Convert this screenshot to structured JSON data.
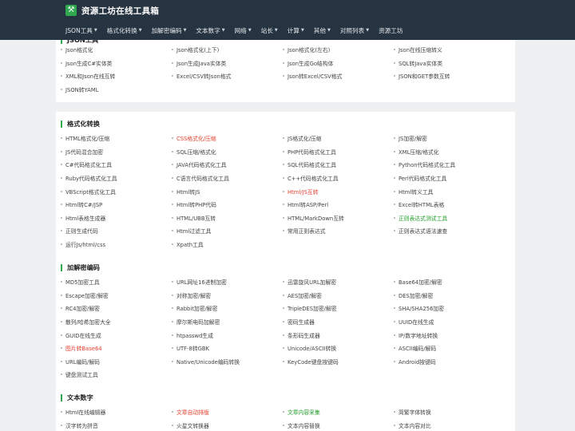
{
  "app": {
    "title": "资源工坊在线工具箱",
    "logo_icon": "wrench-icon",
    "accent_color": "#2fa84f",
    "topbar_color": "#263340"
  },
  "nav": [
    {
      "label": "JSON工具",
      "dropdown": true
    },
    {
      "label": "格式化转换",
      "dropdown": true
    },
    {
      "label": "加解密编码",
      "dropdown": true
    },
    {
      "label": "文本数字",
      "dropdown": true
    },
    {
      "label": "网络",
      "dropdown": true
    },
    {
      "label": "站长",
      "dropdown": true
    },
    {
      "label": "计算",
      "dropdown": true
    },
    {
      "label": "其他",
      "dropdown": true
    },
    {
      "label": "对照列表",
      "dropdown": true
    },
    {
      "label": "资源工坊",
      "dropdown": false
    }
  ],
  "link_colors": {
    "red": "#e4422f",
    "green": "#23a02b"
  },
  "sections": [
    {
      "title": "JSON工具",
      "items": [
        {
          "label": "Json格式化"
        },
        {
          "label": "Json格式化(上下)"
        },
        {
          "label": "Json格式化(左右)"
        },
        {
          "label": "Json在线压缩转义"
        },
        {
          "label": "Json生成C#实体类"
        },
        {
          "label": "Json生成Java实体类"
        },
        {
          "label": "Json生成Go结构体"
        },
        {
          "label": "SQL转Java实体类"
        },
        {
          "label": "XML和Json在线互转"
        },
        {
          "label": "Excel/CSV转Json格式"
        },
        {
          "label": "Json转Excel/CSV格式"
        },
        {
          "label": "JSON和GET参数互转"
        },
        {
          "label": "JSON转YAML"
        }
      ]
    },
    {
      "title": "格式化转换",
      "items": [
        {
          "label": "HTML格式化/压缩"
        },
        {
          "label": "CSS格式化/压缩",
          "color": "red"
        },
        {
          "label": "JS格式化/压缩"
        },
        {
          "label": "JS加密/解密"
        },
        {
          "label": "JS代码混合加密"
        },
        {
          "label": "SQL压缩/格式化"
        },
        {
          "label": "PHP代码格式化工具"
        },
        {
          "label": "XML压缩/格式化"
        },
        {
          "label": "C#代码格式化工具"
        },
        {
          "label": "JAVA代码格式化工具"
        },
        {
          "label": "SQL代码格式化工具"
        },
        {
          "label": "Python代码格式化工具"
        },
        {
          "label": "Ruby代码格式化工具"
        },
        {
          "label": "C语言代码格式化工具"
        },
        {
          "label": "C++代码格式化工具"
        },
        {
          "label": "Perl代码格式化工具"
        },
        {
          "label": "VBScript格式化工具"
        },
        {
          "label": "Html转JS"
        },
        {
          "label": "Html/JS互转",
          "color": "red"
        },
        {
          "label": "Html转义工具"
        },
        {
          "label": "Html转C#/JSP"
        },
        {
          "label": "Html转PHP代码"
        },
        {
          "label": "Html转ASP/Perl"
        },
        {
          "label": "Excel转HTML表格"
        },
        {
          "label": "Html表格生成器"
        },
        {
          "label": "HTML/UBB互转"
        },
        {
          "label": "HTML/MarkDown互转"
        },
        {
          "label": "正则表达式测试工具",
          "color": "green"
        },
        {
          "label": "正则生成代码"
        },
        {
          "label": "Html过滤工具"
        },
        {
          "label": "常用正则表达式"
        },
        {
          "label": "正则表达式语法速查"
        },
        {
          "label": "运行Js/html/css"
        },
        {
          "label": "Xpath工具"
        }
      ]
    },
    {
      "title": "加解密编码",
      "items": [
        {
          "label": "MD5加密工具"
        },
        {
          "label": "URL网址16进制加密"
        },
        {
          "label": "迅雷旋风URL加解密"
        },
        {
          "label": "Base64加密/解密"
        },
        {
          "label": "Escape加密/解密"
        },
        {
          "label": "对称加密/解密"
        },
        {
          "label": "AES加密/解密"
        },
        {
          "label": "DES加密/解密"
        },
        {
          "label": "RC4加密/解密"
        },
        {
          "label": "Rabbit加密/解密"
        },
        {
          "label": "TripleDES加密/解密"
        },
        {
          "label": "SHA/SHA256加密"
        },
        {
          "label": "散列/哈希加密大全"
        },
        {
          "label": "摩尔斯电码加解密"
        },
        {
          "label": "密码生成器"
        },
        {
          "label": "UUID在线生成"
        },
        {
          "label": "GUID在线生成"
        },
        {
          "label": "htpasswd生成"
        },
        {
          "label": "条形码生成器"
        },
        {
          "label": "IP/数字地址转换"
        },
        {
          "label": "图片转Base64",
          "color": "red"
        },
        {
          "label": "UTF-8转GBK"
        },
        {
          "label": "Unicode/ASCII转换"
        },
        {
          "label": "ASCII编码/解码"
        },
        {
          "label": "URL编码/解码"
        },
        {
          "label": "Native/Unicode编码转换"
        },
        {
          "label": "KeyCode键盘按键码"
        },
        {
          "label": "Android按键码"
        },
        {
          "label": "键盘测试工具"
        }
      ]
    },
    {
      "title": "文本数字",
      "items": [
        {
          "label": "Html在线编辑器"
        },
        {
          "label": "文章自动排版",
          "color": "red"
        },
        {
          "label": "文章内容采集",
          "color": "green"
        },
        {
          "label": "简繁字体转换"
        },
        {
          "label": "汉字转为拼音"
        },
        {
          "label": "火星文转换器"
        },
        {
          "label": "文本内容替换"
        },
        {
          "label": "文本内容对比"
        }
      ]
    }
  ]
}
